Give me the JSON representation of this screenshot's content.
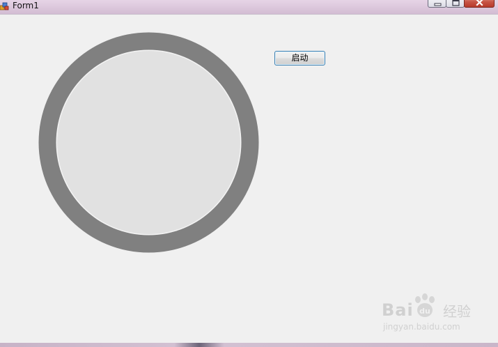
{
  "window": {
    "title": "Form1"
  },
  "form": {
    "start_button_label": "启动"
  },
  "colors": {
    "gauge_ring": "#808080",
    "gauge_face": "#e1e1e1",
    "form_background": "#f0f0f0",
    "button_border": "#3c7fb1"
  },
  "icons": {
    "app": "winforms-app-icon",
    "minimize": "minimize-icon",
    "maximize": "maximize-icon",
    "close": "close-icon"
  },
  "watermark": {
    "brand": "Bai",
    "brand_suffix": "经验",
    "url": "jingyan.baidu.com"
  }
}
